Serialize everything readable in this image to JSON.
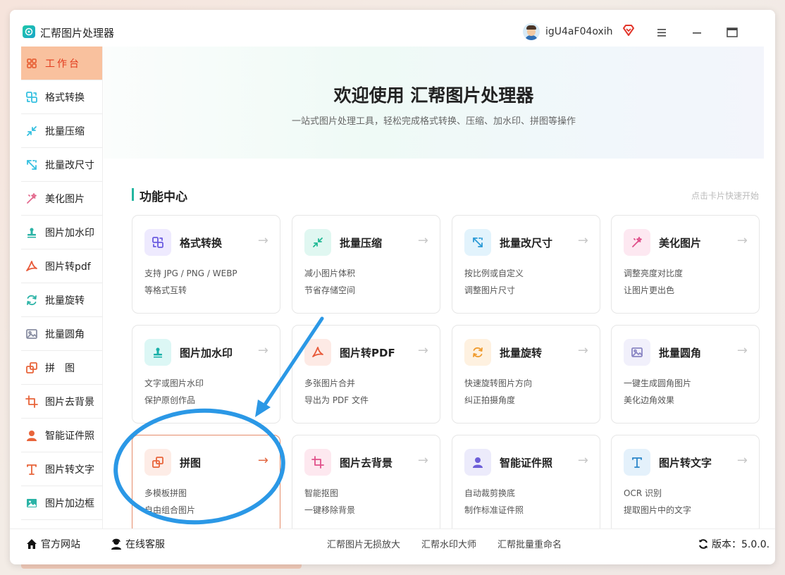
{
  "app": {
    "title": "汇帮图片处理器",
    "username": "igU4aF04oxih"
  },
  "sidebar": {
    "items": [
      {
        "label": "工作台",
        "icon": "grid-icon",
        "color": "#e8643a"
      },
      {
        "label": "格式转换",
        "icon": "convert-icon",
        "color": "#35c0e0"
      },
      {
        "label": "批量压缩",
        "icon": "compress-icon",
        "color": "#35c0e0"
      },
      {
        "label": "批量改尺寸",
        "icon": "resize-icon",
        "color": "#35c0e0"
      },
      {
        "label": "美化图片",
        "icon": "magic-wand-icon",
        "color": "#e36b8f"
      },
      {
        "label": "图片加水印",
        "icon": "stamp-icon",
        "color": "#2bb3a6"
      },
      {
        "label": "图片转pdf",
        "icon": "pdf-icon",
        "color": "#e85a3a"
      },
      {
        "label": "批量旋转",
        "icon": "rotate-icon",
        "color": "#2bb3a6"
      },
      {
        "label": "批量圆角",
        "icon": "image-icon",
        "color": "#8a8fa3"
      },
      {
        "label": "拼　图",
        "icon": "puzzle-icon",
        "color": "#e8643a"
      },
      {
        "label": "图片去背景",
        "icon": "crop-icon",
        "color": "#e8643a"
      },
      {
        "label": "智能证件照",
        "icon": "person-icon",
        "color": "#e8643a"
      },
      {
        "label": "图片转文字",
        "icon": "text-icon",
        "color": "#e8643a"
      },
      {
        "label": "图片加边框",
        "icon": "frame-icon",
        "color": "#2bb3a6"
      }
    ]
  },
  "banner": {
    "title": "欢迎使用 汇帮图片处理器",
    "subtitle": "一站式图片处理工具，轻松完成格式转换、压缩、加水印、拼图等操作"
  },
  "section": {
    "title": "功能中心",
    "hint": "点击卡片快速开始"
  },
  "cards": [
    {
      "title": "格式转换",
      "d1": "支持 JPG / PNG / WEBP",
      "d2": "等格式互转",
      "icon": "convert-icon",
      "bg": "#eeeafe",
      "fg": "#6a5be0"
    },
    {
      "title": "批量压缩",
      "d1": "减小图片体积",
      "d2": "节省存储空间",
      "icon": "compress-icon",
      "bg": "#e0f7f1",
      "fg": "#1fb894"
    },
    {
      "title": "批量改尺寸",
      "d1": "按比例或自定义",
      "d2": "调整图片尺寸",
      "icon": "resize-icon",
      "bg": "#e2f3fc",
      "fg": "#2b9ad6"
    },
    {
      "title": "美化图片",
      "d1": "调整亮度对比度",
      "d2": "让图片更出色",
      "icon": "magic-wand-icon",
      "bg": "#fde8f1",
      "fg": "#e0508a"
    },
    {
      "title": "图片加水印",
      "d1": "文字或图片水印",
      "d2": "保护原创作品",
      "icon": "stamp-icon",
      "bg": "#dcf7f5",
      "fg": "#18b0a8"
    },
    {
      "title": "图片转PDF",
      "d1": "多张图片合并",
      "d2": "导出为 PDF 文件",
      "icon": "pdf-icon",
      "bg": "#fdeae5",
      "fg": "#e85a3a"
    },
    {
      "title": "批量旋转",
      "d1": "快速旋转图片方向",
      "d2": "纠正拍摄角度",
      "icon": "rotate-icon",
      "bg": "#fef1e0",
      "fg": "#ef9a2c"
    },
    {
      "title": "批量圆角",
      "d1": "一键生成圆角图片",
      "d2": "美化边角效果",
      "icon": "image-icon",
      "bg": "#f1f0fb",
      "fg": "#8a86c4"
    },
    {
      "title": "拼图",
      "d1": "多模板拼图",
      "d2": "自由组合图片",
      "icon": "puzzle-icon",
      "bg": "#fdece6",
      "fg": "#e8643a",
      "highlight": true
    },
    {
      "title": "图片去背景",
      "d1": "智能抠图",
      "d2": "一键移除背景",
      "icon": "crop-icon",
      "bg": "#fde8ef",
      "fg": "#e0508a"
    },
    {
      "title": "智能证件照",
      "d1": "自动裁剪换底",
      "d2": "制作标准证件照",
      "icon": "person-icon",
      "bg": "#ecebfb",
      "fg": "#6d5fd8"
    },
    {
      "title": "图片转文字",
      "d1": "OCR 识别",
      "d2": "提取图片中的文字",
      "icon": "text-icon",
      "bg": "#e4f1fb",
      "fg": "#2b86c9"
    }
  ],
  "footer": {
    "website": "官方网站",
    "support": "在线客服",
    "links": [
      "汇帮图片无损放大",
      "汇帮水印大师",
      "汇帮批量重命名"
    ],
    "version": "版本：5.0.0."
  }
}
